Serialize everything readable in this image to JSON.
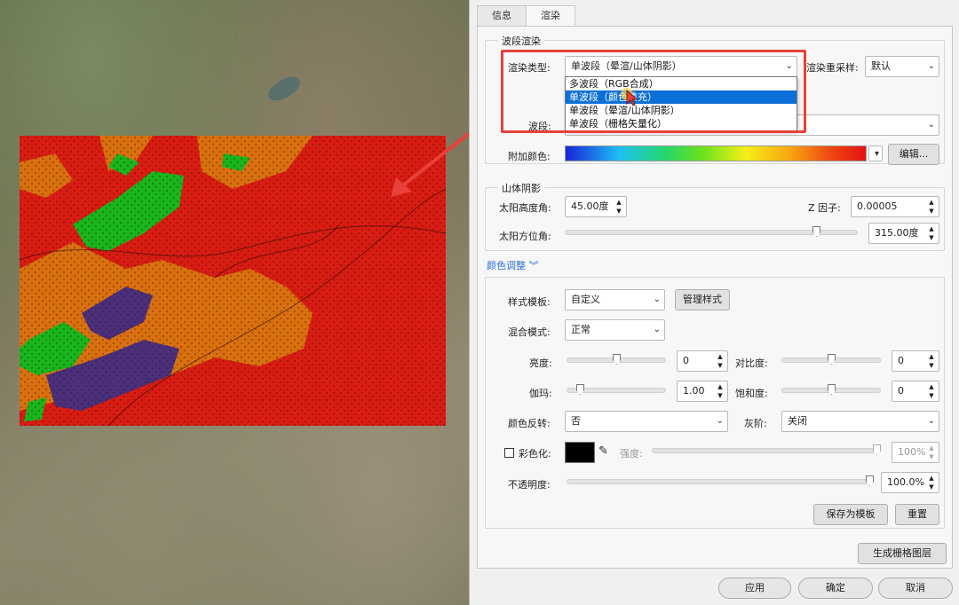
{
  "tabs": [
    {
      "label": "信息",
      "active": false
    },
    {
      "label": "渲染",
      "active": true
    }
  ],
  "band_render": {
    "group_title": "波段渲染",
    "render_type_label": "渲染类型:",
    "render_type_value": "单波段（晕渲/山体阴影）",
    "render_type_options": [
      "多波段（RGB合成）",
      "单波段（颜色填充）",
      "单波段（晕渲/山体阴影）",
      "单波段（栅格矢量化）"
    ],
    "selected_option_index": 1,
    "resample_label": "渲染重采样:",
    "resample_value": "默认",
    "band_label": "波段:",
    "extra_color_label": "附加颜色:",
    "edit_button": "编辑..."
  },
  "hillshade": {
    "group_title": "山体阴影",
    "sun_altitude_label": "太阳高度角:",
    "sun_altitude_value": "45.00度",
    "z_factor_label": "Z 因子:",
    "z_factor_value": "0.00005",
    "sun_azimuth_label": "太阳方位角:",
    "sun_azimuth_value": "315.00度",
    "sun_azimuth_level": 0.875
  },
  "color_adjust": {
    "toggle_label": "颜色调整",
    "style_template_label": "样式模板:",
    "style_template_value": "自定义",
    "manage_style_button": "管理样式",
    "blend_mode_label": "混合模式:",
    "blend_mode_value": "正常",
    "brightness_label": "亮度:",
    "brightness_value": "0",
    "contrast_label": "对比度:",
    "contrast_value": "0",
    "gamma_label": "伽玛:",
    "gamma_value": "1.00",
    "saturation_label": "饱和度:",
    "saturation_value": "0",
    "invert_label": "颜色反转:",
    "invert_value": "否",
    "grayscale_label": "灰阶:",
    "grayscale_value": "关闭",
    "colorize_label": "彩色化:",
    "colorize_color": "#000000",
    "strength_label": "强度:",
    "strength_value": "100%",
    "opacity_label": "不透明度:",
    "opacity_value": "100.0%",
    "save_template_button": "保存为模板",
    "reset_button": "重置"
  },
  "generate_button": "生成栅格图层",
  "footer": {
    "apply": "应用",
    "ok": "确定",
    "cancel": "取消"
  },
  "colors": {
    "raster_red": "#d81c12",
    "raster_orange": "#d9700e",
    "raster_green": "#18b51c",
    "raster_purple": "#4a2f7a",
    "annotation_red": "#e8403a",
    "selection_blue": "#0a6fd6"
  }
}
